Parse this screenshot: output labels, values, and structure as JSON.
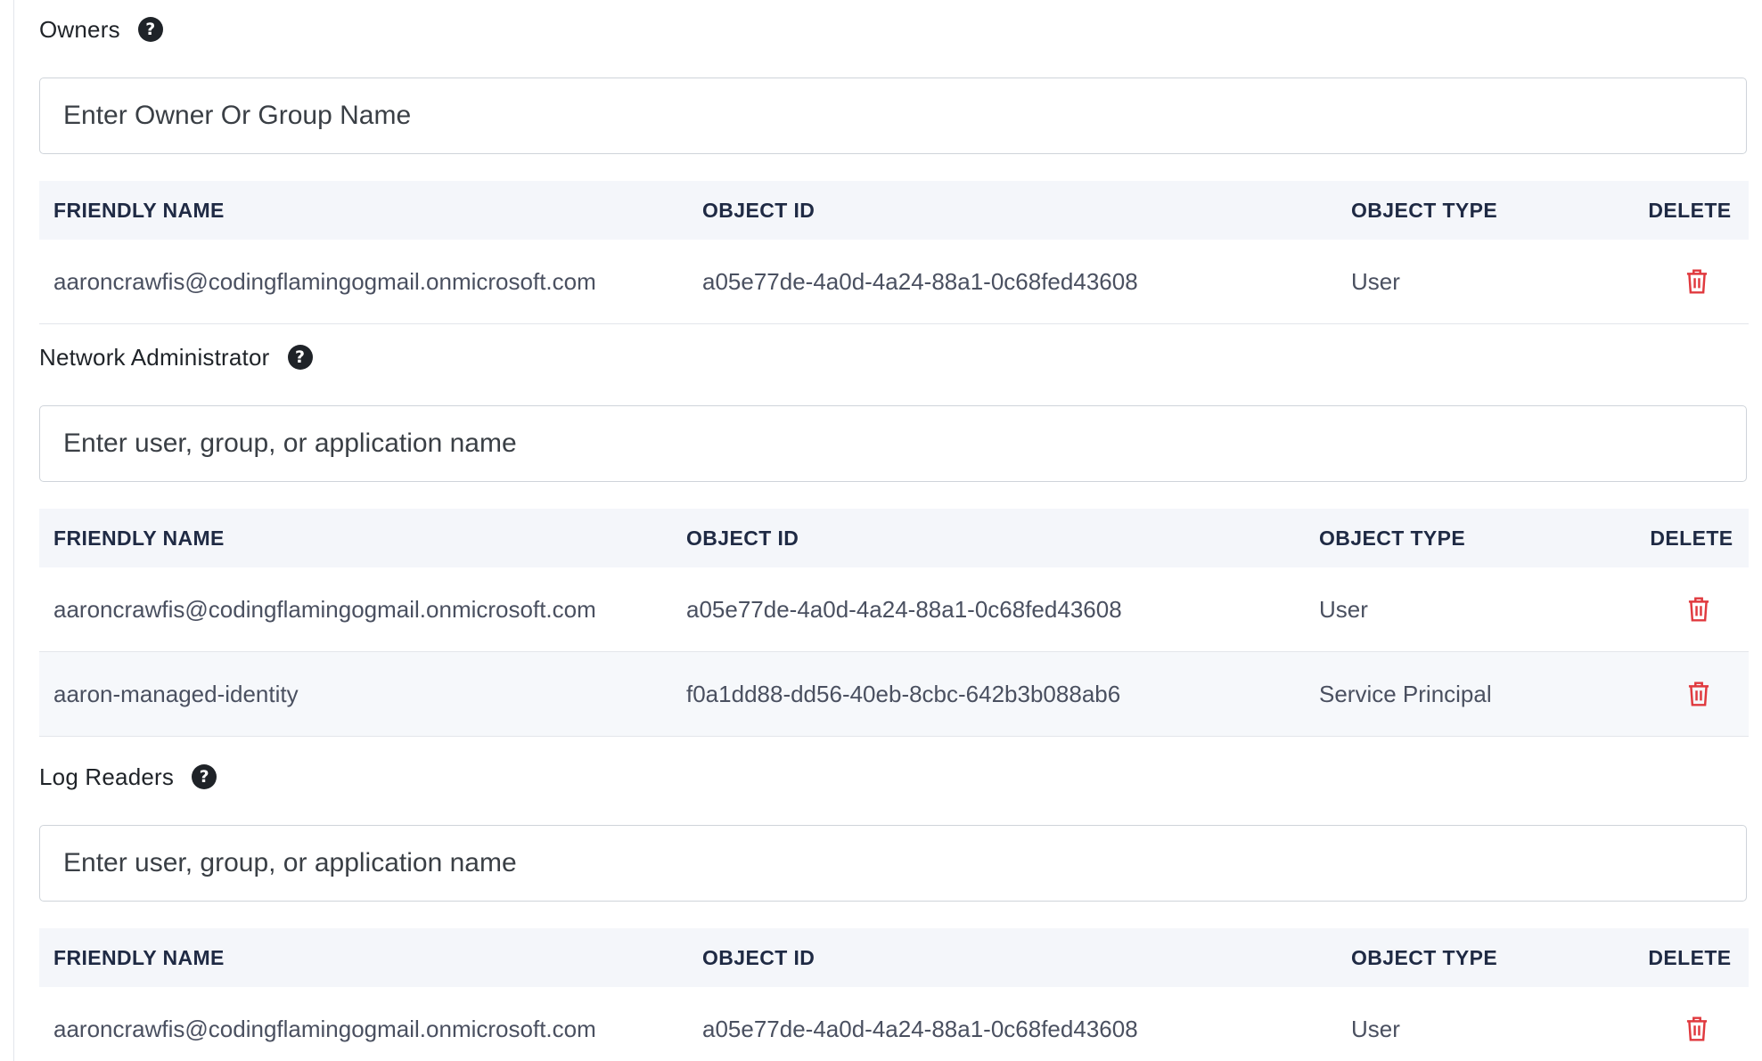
{
  "sections": [
    {
      "title": "Owners",
      "input_placeholder": "Enter Owner Or Group Name",
      "columns": [
        "FRIENDLY NAME",
        "OBJECT ID",
        "OBJECT TYPE",
        "DELETE"
      ],
      "rows": [
        {
          "friendly_name": "aaroncrawfis@codingflamingogmail.onmicrosoft.com",
          "object_id": "a05e77de-4a0d-4a24-88a1-0c68fed43608",
          "object_type": "User"
        }
      ]
    },
    {
      "title": "Network Administrator",
      "input_placeholder": "Enter user, group, or application name",
      "columns": [
        "FRIENDLY NAME",
        "OBJECT ID",
        "OBJECT TYPE",
        "DELETE"
      ],
      "rows": [
        {
          "friendly_name": "aaroncrawfis@codingflamingogmail.onmicrosoft.com",
          "object_id": "a05e77de-4a0d-4a24-88a1-0c68fed43608",
          "object_type": "User"
        },
        {
          "friendly_name": "aaron-managed-identity",
          "object_id": "f0a1dd88-dd56-40eb-8cbc-642b3b088ab6",
          "object_type": "Service Principal"
        }
      ]
    },
    {
      "title": "Log Readers",
      "input_placeholder": "Enter user, group, or application name",
      "columns": [
        "FRIENDLY NAME",
        "OBJECT ID",
        "OBJECT TYPE",
        "DELETE"
      ],
      "rows": [
        {
          "friendly_name": "aaroncrawfis@codingflamingogmail.onmicrosoft.com",
          "object_id": "a05e77de-4a0d-4a24-88a1-0c68fed43608",
          "object_type": "User"
        }
      ]
    }
  ],
  "icons": {
    "help": "help-icon",
    "delete": "trash-icon"
  },
  "colors": {
    "delete_red": "#e0393e",
    "header_bg": "#f4f6fa",
    "alt_row_bg": "#f6f8fb"
  }
}
